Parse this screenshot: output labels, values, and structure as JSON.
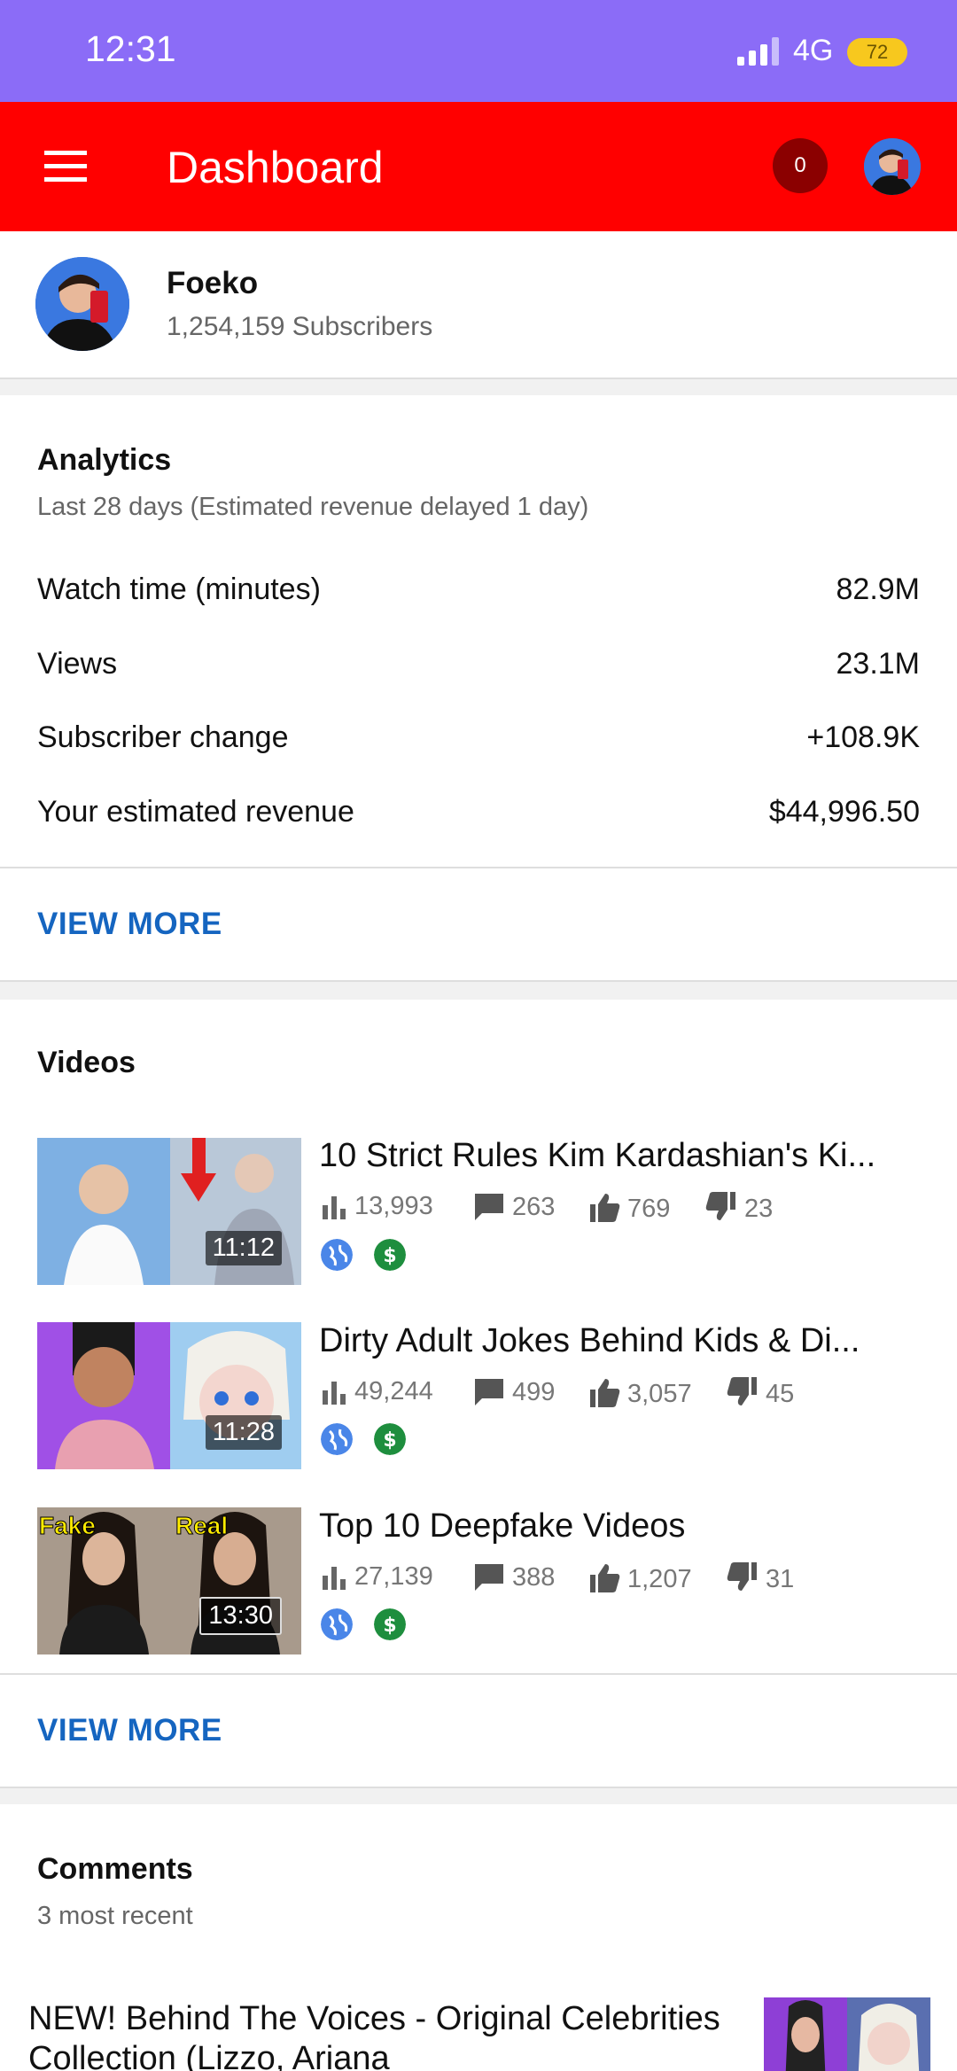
{
  "status_bar": {
    "time": "12:31",
    "network": "4G",
    "battery": "72",
    "bg_color": "#8b6cf7"
  },
  "app_bar": {
    "title": "Dashboard",
    "notification_count": "0",
    "bg_color": "#ff0000"
  },
  "channel": {
    "name": "Foeko",
    "subscribers": "1,254,159 Subscribers"
  },
  "analytics": {
    "title": "Analytics",
    "subtitle": "Last 28 days (Estimated revenue delayed 1 day)",
    "rows": [
      {
        "label": "Watch time (minutes)",
        "value": "82.9M"
      },
      {
        "label": "Views",
        "value": "23.1M"
      },
      {
        "label": "Subscriber change",
        "value": "+108.9K"
      },
      {
        "label": "Your estimated revenue",
        "value": "$44,996.50"
      }
    ],
    "view_more": "VIEW MORE"
  },
  "videos": {
    "title": "Videos",
    "items": [
      {
        "title": "10 Strict Rules Kim Kardashian's Ki...",
        "duration": "11:12",
        "views": "13,993",
        "comments": "263",
        "likes": "769",
        "dislikes": "23"
      },
      {
        "title": "Dirty Adult Jokes Behind Kids & Di...",
        "duration": "11:28",
        "views": "49,244",
        "comments": "499",
        "likes": "3,057",
        "dislikes": "45"
      },
      {
        "title": "Top 10 Deepfake Videos",
        "duration": "13:30",
        "views": "27,139",
        "comments": "388",
        "likes": "1,207",
        "dislikes": "31",
        "thumb_left_text": "Fake",
        "thumb_right_text": "Real"
      }
    ],
    "view_more": "VIEW MORE"
  },
  "comments": {
    "title": "Comments",
    "subtitle": "3 most recent",
    "first_video_title": "NEW! Behind The Voices - Original Celebrities Collection (Lizzo, Ariana"
  }
}
